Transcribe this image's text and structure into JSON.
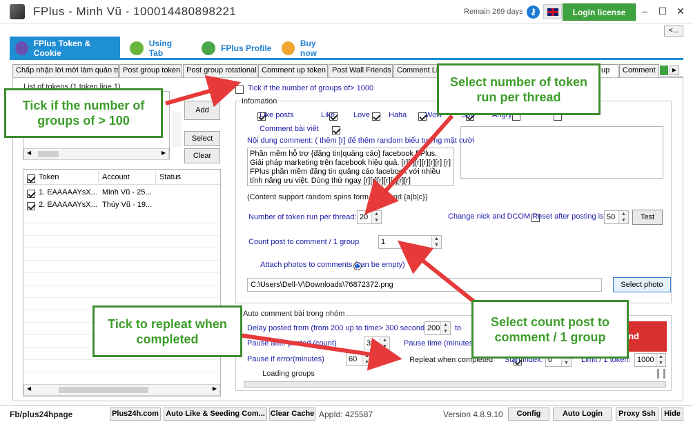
{
  "window": {
    "title": "FPlus - Minh Vũ - 100014480898221",
    "remain": "Remain 269 days",
    "login_license": "Login license",
    "minimize": "–",
    "maximize": "☐",
    "close": "✕",
    "collapse": "<..."
  },
  "main_tabs": [
    {
      "label": "FPlus Token & Cookie"
    },
    {
      "label": "Using Tab"
    },
    {
      "label": "FPlus Profile"
    },
    {
      "label": "Buy now"
    }
  ],
  "sub_tabs": [
    "Chấp nhận lời mời làm quản trị",
    "Post group token",
    "Post group rotational",
    "Comment up token",
    "Post Wall Friends",
    "Comment Li",
    "up",
    "Comment"
  ],
  "left_panel": {
    "list_title": "List of tokens (1 token line 1)",
    "add": "Add",
    "select": "Select",
    "clear": "Clear",
    "grid_headers": {
      "token": "Token",
      "account": "Account",
      "status": "Status"
    },
    "rows": [
      {
        "token": "1. EAAAAAYsX...",
        "account": "Minh Vũ - 25..."
      },
      {
        "token": "2. EAAAAAYsX...",
        "account": "Thúy Vũ - 19..."
      }
    ]
  },
  "right": {
    "tick_groups": "Tick if the number of groups of> 1000",
    "infomation": "Infomation",
    "reactions": [
      "Like posts",
      "Like",
      "Love",
      "Haha",
      "Wow",
      "Sad",
      "Angry"
    ],
    "comment_bai_viet": "Comment bài viết",
    "noi_dung": "Nội dung comment: ( thêm [r] để thêm random biểu tượng mặt cười",
    "comment_text": "Phần mềm hỗ trợ {đăng tin|quảng cáo} facebook FPlus. Giải pháp marketing trên facebook hiệu quả. [r][r][r][r][r][r] [r] FPlus phần mềm đăng tin quảng cáo facebook với nhiều tính năng ưu việt. Dùng thử ngay [r][r][r][r][r][r][r]",
    "support_spins": "(Content support random spins form a|b|c and {a|b|c})",
    "token_per_thread_label": "Number of token run per thread:",
    "token_per_thread": "20",
    "change_nick": "Change nick and DCOM Reset after posting is",
    "change_nick_value": "50",
    "test": "Test",
    "count_post_label": "Count post to comment / 1 group",
    "count_post": "1",
    "attach_photos": "Attach photos to comments (can be empty)",
    "photo_path": "C:\\Users\\Dell-V\\Downloads\\76872372.png",
    "select_photo": "Select photo"
  },
  "auto": {
    "legend": "Auto comment bài trong nhóm",
    "delay_label": "Delay posted from (from 200 up to time> 300 seconds)",
    "delay_from": "200",
    "to": "to",
    "pause_after": "Pause after posted (count)",
    "pause_after_value": "30",
    "pause_time": "Pause time (minutes)",
    "pause_error": "Pause if error(minutes)",
    "pause_error_value": "60",
    "repeat": "Repleat when completed",
    "start_index": "Start index:",
    "start_index_value": "0",
    "limit_token": "Limit / 1 token:",
    "limit_token_value": "1000",
    "loading_groups": "Loading groups",
    "run_button": "nd"
  },
  "callouts": {
    "tick_groups": "Tick if the number of groups of > 100",
    "select_token": "Select number of token run per thread",
    "tick_repeat": "Tick to repleat when completed",
    "select_count": "Select count post to comment / 1 group"
  },
  "statusbar": {
    "fb": "Fb/plus24hpage",
    "plus24h": "Plus24h.com",
    "auto_like": "Auto Like & Seeding Com...",
    "clear_cache": "Clear Cache",
    "appid": "AppId: 425587",
    "version": "Version 4.8.9.10",
    "config": "Config",
    "auto_login": "Auto Login",
    "proxy_ssh": "Proxy Ssh",
    "hide": "Hide"
  }
}
